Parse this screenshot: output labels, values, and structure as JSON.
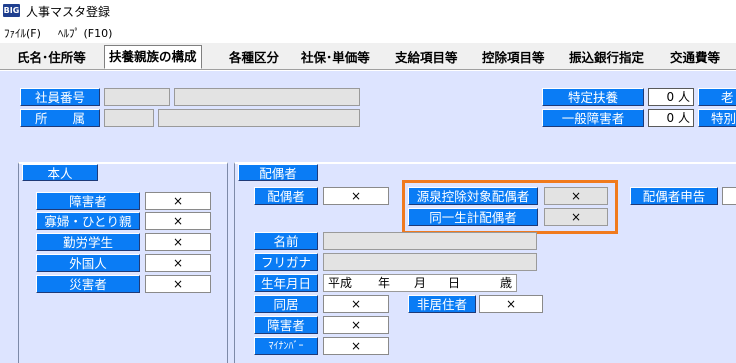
{
  "window": {
    "icon_text": "BIG",
    "title": "人事マスタ登録"
  },
  "menu": [
    {
      "label": "ﾌｧｲﾙ(F)"
    },
    {
      "label": "ﾍﾙﾌﾟ (F10)"
    }
  ],
  "tabs": [
    {
      "label": "氏名･住所等"
    },
    {
      "label": "扶養親族の構成"
    },
    {
      "label": "各種区分"
    },
    {
      "label": "社保･単価等"
    },
    {
      "label": "支給項目等"
    },
    {
      "label": "控除項目等"
    },
    {
      "label": "振込銀行指定"
    },
    {
      "label": "交通費等"
    }
  ],
  "header": {
    "employee_no_label": "社員番号",
    "department_label": "所　　属",
    "specific_dependent_label": "特定扶養",
    "specific_dependent_count": "0 人",
    "general_disabled_label": "一般障害者",
    "general_disabled_count": "0 人",
    "elderly_label": "老",
    "special_label": "特別"
  },
  "self_panel": {
    "title": "本人",
    "rows": [
      {
        "label": "障害者",
        "value": "×"
      },
      {
        "label": "寡婦・ひとり親",
        "value": "×"
      },
      {
        "label": "勤労学生",
        "value": "×"
      },
      {
        "label": "外国人",
        "value": "×"
      },
      {
        "label": "災害者",
        "value": "×"
      }
    ]
  },
  "spouse_panel": {
    "title": "配偶者",
    "spouse_label": "配偶者",
    "spouse_value": "×",
    "withholding_spouse_label": "源泉控除対象配偶者",
    "withholding_spouse_value": "×",
    "same_household_label": "同一生計配偶者",
    "same_household_value": "×",
    "spouse_declaration_label": "配偶者申告",
    "name_label": "名前",
    "furigana_label": "フリガナ",
    "birthdate_label": "生年月日",
    "birthdate_era": "平成",
    "birthdate_year_unit": "年",
    "birthdate_month_unit": "月",
    "birthdate_day_unit": "日",
    "birthdate_age_unit": "歳",
    "cohabit_label": "同居",
    "cohabit_value": "×",
    "nonresident_label": "非居住者",
    "nonresident_value": "×",
    "disabled_label": "障害者",
    "disabled_value": "×",
    "mynumber_label": "ﾏｲﾅﾝﾊﾞｰ",
    "mynumber_value": "×"
  },
  "colors": {
    "label_bg": "#0a7cf5",
    "panel_bg": "#dde4ff",
    "highlight": "#f07a1e"
  }
}
